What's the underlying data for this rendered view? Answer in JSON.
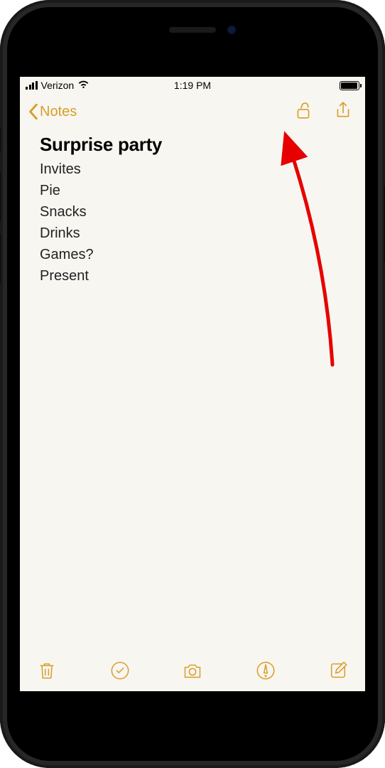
{
  "status_bar": {
    "carrier": "Verizon",
    "time": "1:19 PM"
  },
  "nav": {
    "back_label": "Notes"
  },
  "note": {
    "title": "Surprise party",
    "items": [
      "Invites",
      "Pie",
      "Snacks",
      "Drinks",
      "Games?",
      "Present"
    ]
  },
  "colors": {
    "accent": "#d99e28",
    "arrow": "#e60000"
  }
}
